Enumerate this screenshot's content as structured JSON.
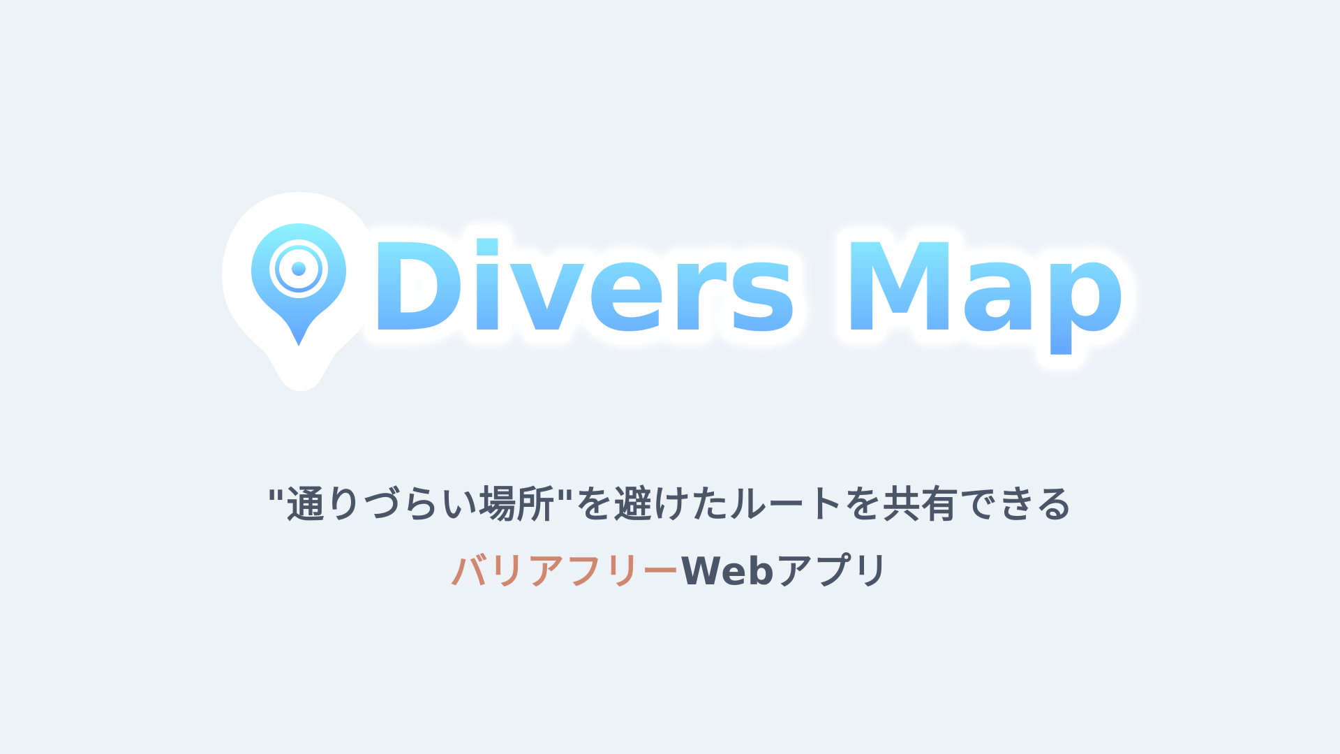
{
  "logo": {
    "icon": "map-pin-icon",
    "title": "Divers Map",
    "gradient_top": "#8ef3ff",
    "gradient_bottom": "#63a4ff",
    "outline_color": "#ffffff"
  },
  "tagline": {
    "line1": "\"通りづらい場所\"を避けたルートを共有できる",
    "line2_accent": "バリアフリー",
    "line2_rest": "Webアプリ",
    "text_color": "#4a5568",
    "accent_color": "#d08770"
  }
}
